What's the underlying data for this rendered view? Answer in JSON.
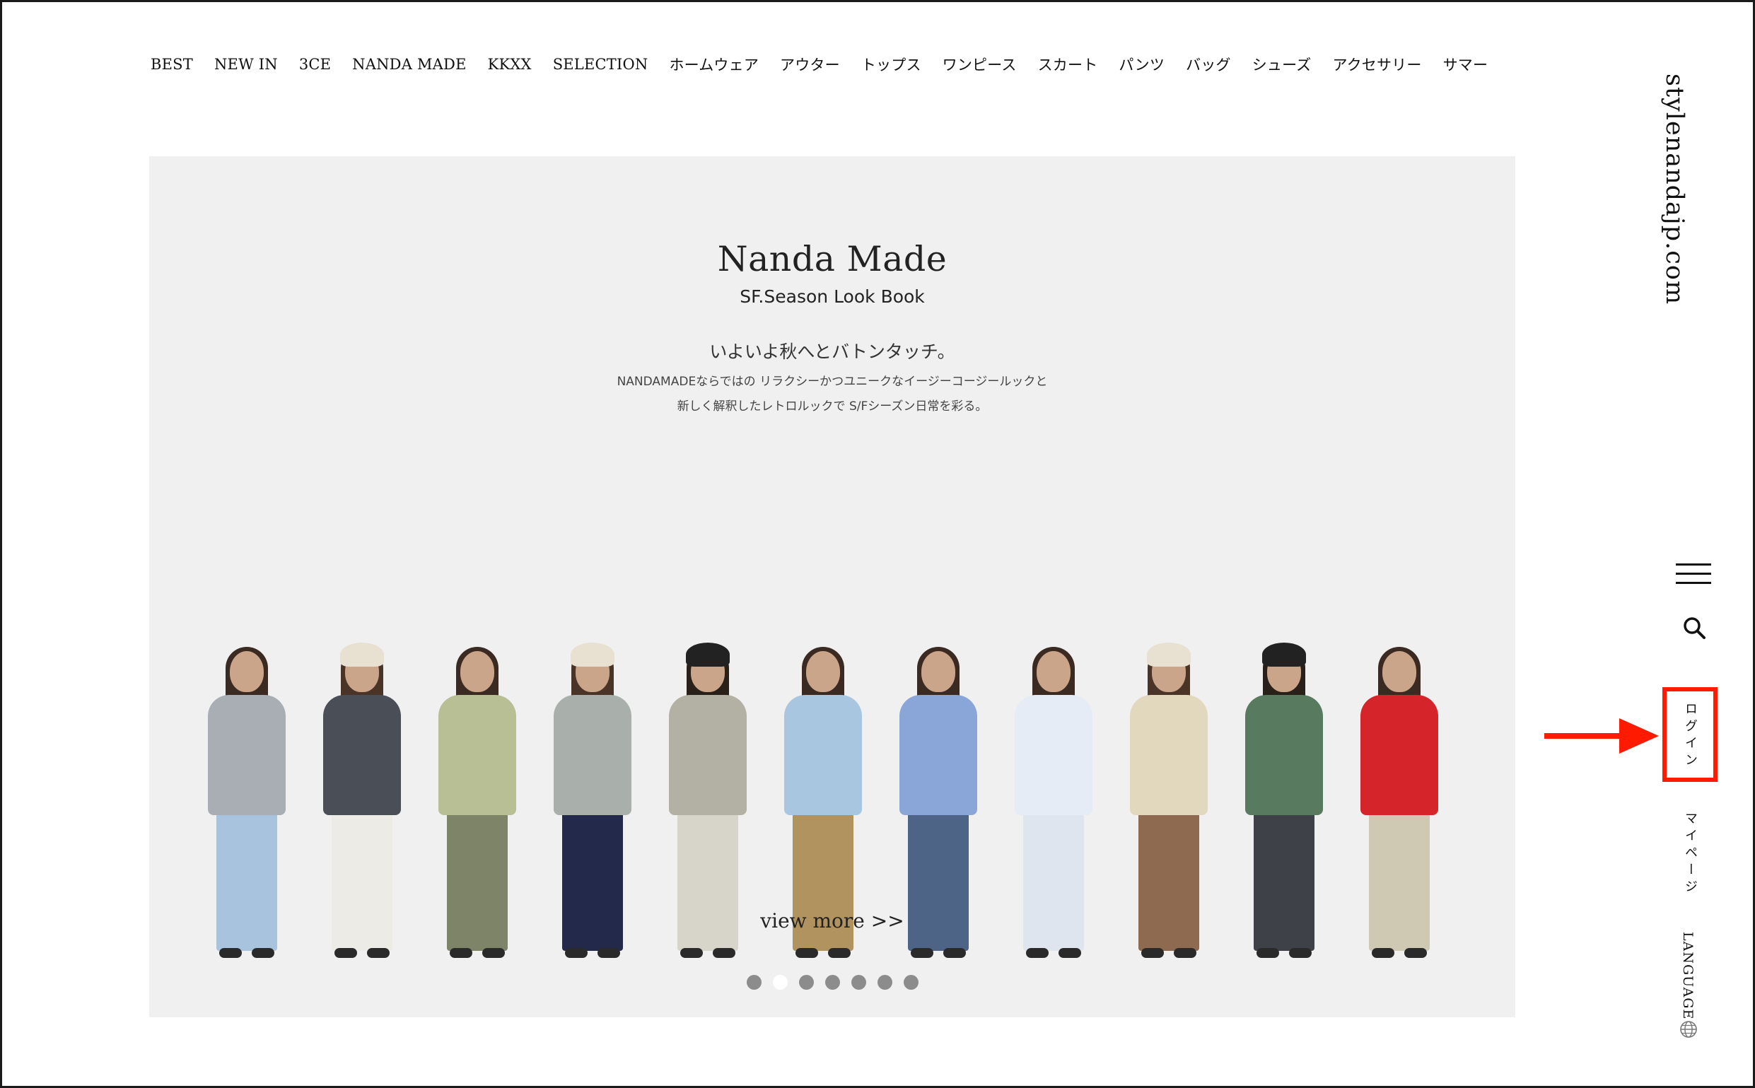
{
  "nav": {
    "items": [
      "BEST",
      "NEW IN",
      "3CE",
      "NANDA MADE",
      "KKXX",
      "SELECTION",
      "ホームウェア",
      "アウター",
      "トップス",
      "ワンピース",
      "スカート",
      "パンツ",
      "バッグ",
      "シューズ",
      "アクセサリー",
      "サマー"
    ]
  },
  "brand": {
    "name": "stylenandajp.com"
  },
  "banner": {
    "title": "Nanda Made",
    "subtitle": "SF.Season Look Book",
    "headline_jp": "いよいよ秋へとバトンタッチ。",
    "desc_line1": "NANDAMADEならではの リラクシーかつユニークなイージーコージールックと",
    "desc_line2": "新しく解釈したレトロルックで S/Fシーズン日常を彩る。",
    "view_more": "view more >>",
    "slide_count": 7,
    "active_slide": 2
  },
  "rail": {
    "login": "ログイン",
    "mypage": "マイページ",
    "language": "LANGUAGE",
    "icons": [
      "hamburger-menu-icon",
      "search-icon",
      "globe-icon"
    ]
  },
  "annotation": {
    "highlight_color": "#ff1a00",
    "target": "login"
  },
  "models": [
    {
      "top": "#a9aeb5",
      "bottom": "#a8c3dd",
      "hair": "#3a2a22",
      "hat": null
    },
    {
      "top": "#4a4f57",
      "bottom": "#ecebe6",
      "hair": "#4a3428",
      "hat": "#e8e1d2"
    },
    {
      "top": "#b9bf94",
      "bottom": "#7e8468",
      "hair": "#3a2a22",
      "hat": null
    },
    {
      "top": "#a9b0ac",
      "bottom": "#22294a",
      "hair": "#4a3428",
      "hat": "#e8e1d2"
    },
    {
      "top": "#b3b1a4",
      "bottom": "#d7d5ca",
      "hair": "#2a201a",
      "hat": "#222222"
    },
    {
      "top": "#a8c6e0",
      "bottom": "#b1935f",
      "hair": "#3a2a22",
      "hat": null
    },
    {
      "top": "#8aa6d8",
      "bottom": "#4e6486",
      "hair": "#3a2a22",
      "hat": null
    },
    {
      "top": "#e6ecf5",
      "bottom": "#dfe5ef",
      "hair": "#3a2a22",
      "hat": null
    },
    {
      "top": "#e2d8bd",
      "bottom": "#8d6a50",
      "hair": "#4a3428",
      "hat": "#e8e1d2"
    },
    {
      "top": "#587a5e",
      "bottom": "#3e4148",
      "hair": "#2a201a",
      "hat": "#222222"
    },
    {
      "top": "#d6252a",
      "bottom": "#cfc9b4",
      "hair": "#3a2a22",
      "hat": null
    }
  ]
}
